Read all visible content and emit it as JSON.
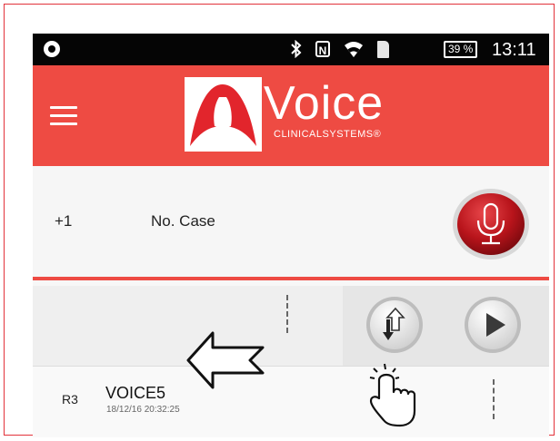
{
  "status_bar": {
    "battery": "39 %",
    "time": "13:11",
    "icons": [
      "app-icon",
      "bluetooth-icon",
      "nfc-icon",
      "wifi-icon",
      "sim-icon",
      "battery-icon"
    ]
  },
  "app_bar": {
    "logo_title": "Voice",
    "logo_subtitle": "CLINICALSYSTEMS®",
    "menu_icon": "hamburger-menu-icon",
    "brand_color": "#ee4b43"
  },
  "case": {
    "number": "+1",
    "label": "No. Case",
    "mic_icon": "microphone-icon"
  },
  "toolbar": {
    "icons": [
      "upload-download-icon",
      "play-icon"
    ]
  },
  "recordings": [
    {
      "code": "R3",
      "title": "VOICE5",
      "date": "18/12/16 20:32:25"
    }
  ],
  "annotations": {
    "arrow": "swipe-left-arrow-icon",
    "hand": "tap-hand-icon"
  }
}
